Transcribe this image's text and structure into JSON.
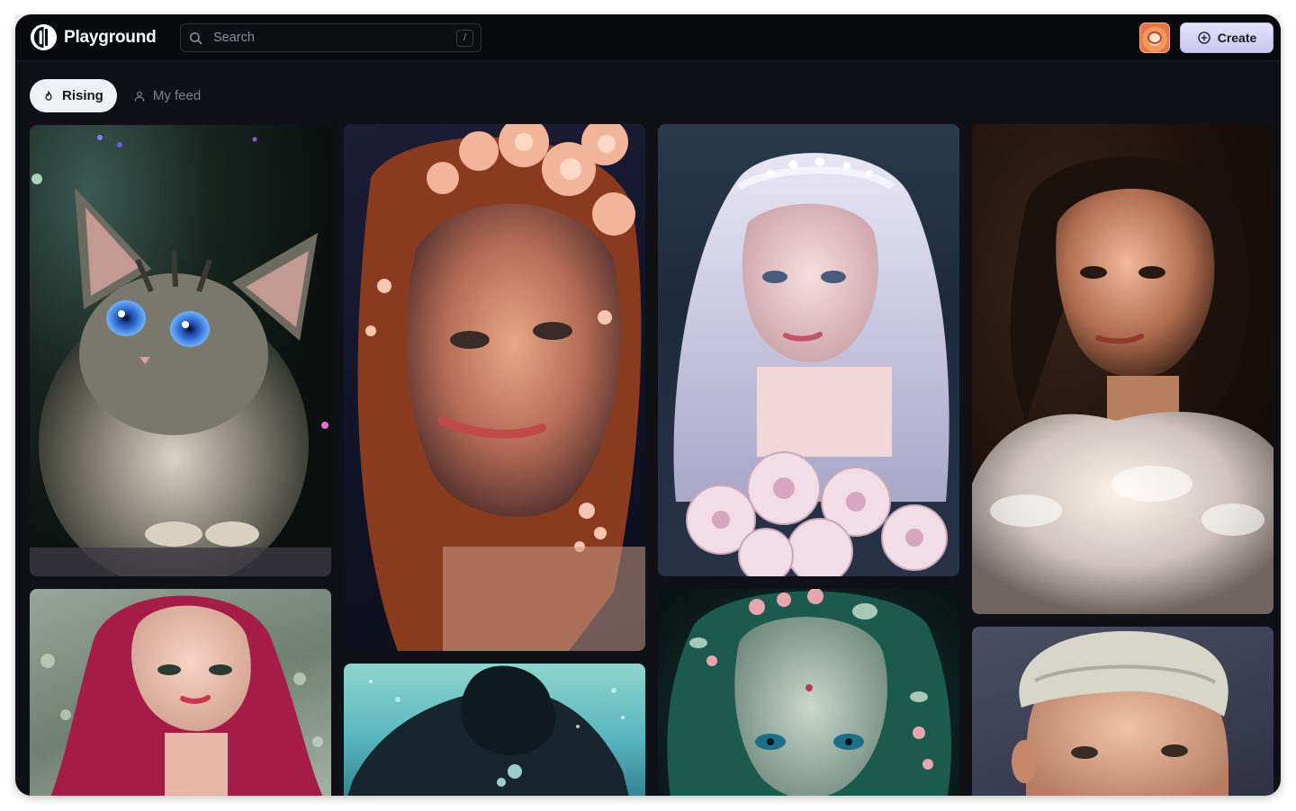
{
  "app": {
    "name": "Playground"
  },
  "search": {
    "placeholder": "Search",
    "shortcut": "/"
  },
  "header": {
    "create_label": "Create"
  },
  "tabs": [
    {
      "label": "Rising",
      "active": true,
      "icon": "flame-icon"
    },
    {
      "label": "My feed",
      "active": false,
      "icon": "user-icon"
    }
  ],
  "gallery": {
    "images": [
      {
        "subject": "fluffy gray kitten with blue eyes"
      },
      {
        "subject": "woman with red hair and flowers"
      },
      {
        "subject": "woman with silver hair, tiara and roses"
      },
      {
        "subject": "woman with dark hair and white fur"
      },
      {
        "subject": "woman with pink hair"
      },
      {
        "subject": "underwater dark hair figure"
      },
      {
        "subject": "teal-haired girl with flower crown"
      },
      {
        "subject": "boy with white cap"
      }
    ]
  },
  "colors": {
    "background": "#0f1116",
    "topbar": "#090a0d",
    "create_button": "#d7d5f6",
    "active_tab": "#eef0f4"
  }
}
